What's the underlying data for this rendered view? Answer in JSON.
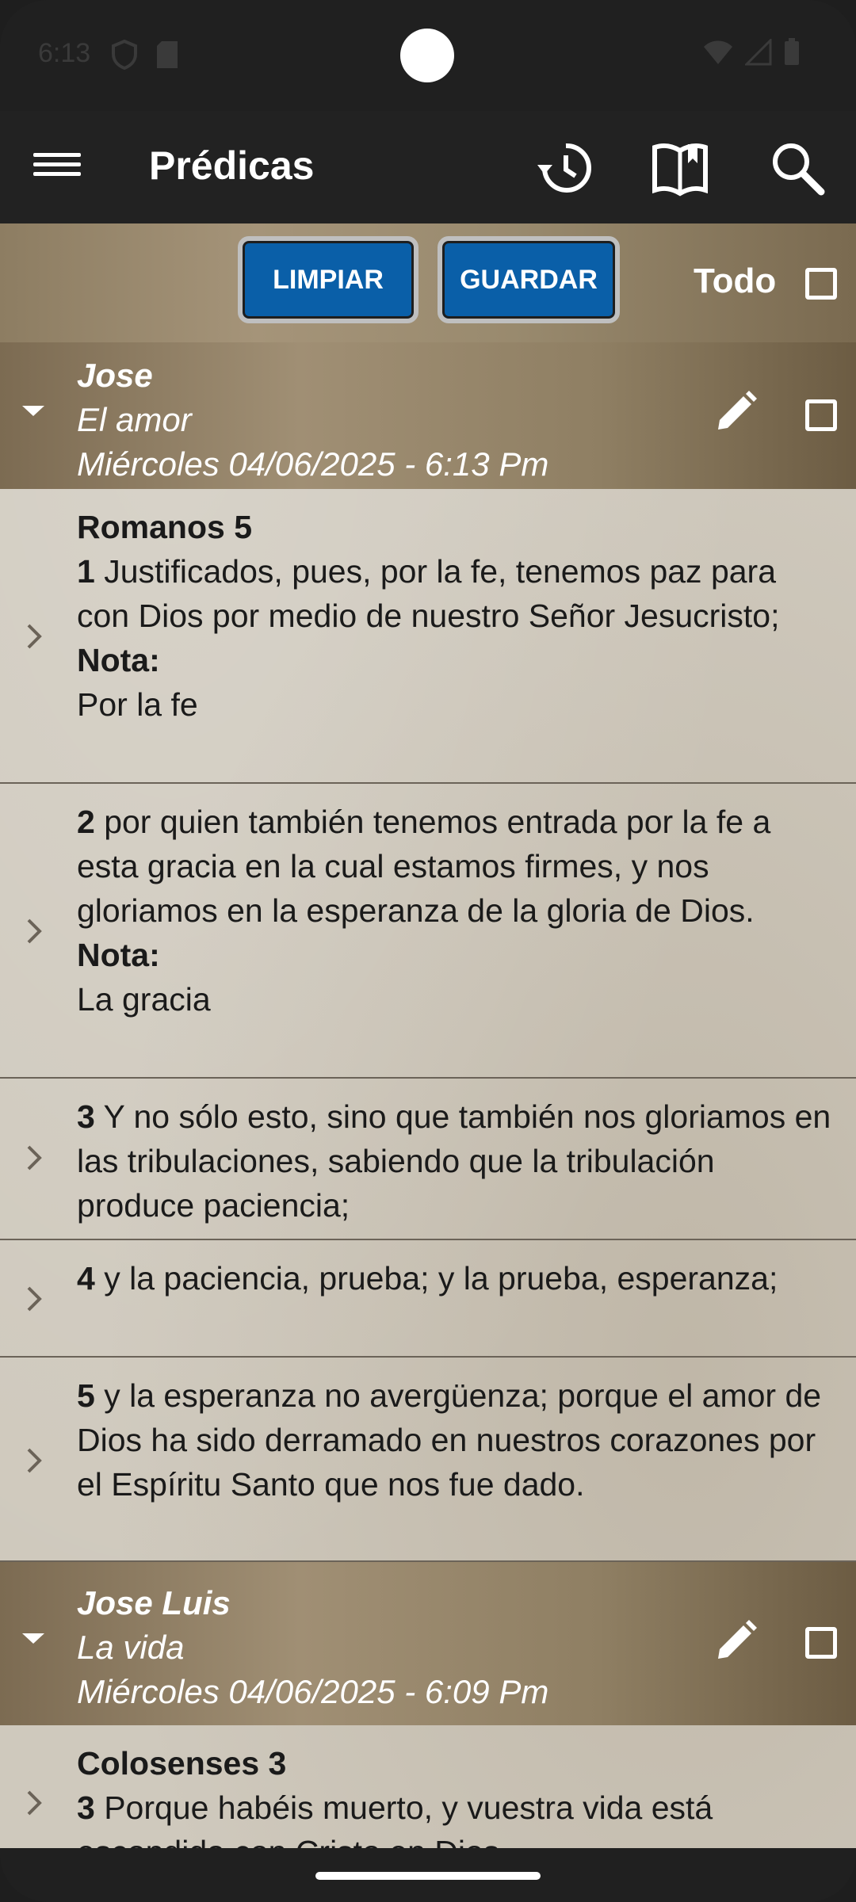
{
  "status_bar": {
    "time": "6:13"
  },
  "app_bar": {
    "title": "Prédicas",
    "icons": [
      "menu-icon",
      "history-icon",
      "book-icon",
      "search-icon"
    ]
  },
  "toolbar": {
    "clear_label": "LIMPIAR",
    "save_label": "GUARDAR",
    "all_label": "Todo"
  },
  "groups": [
    {
      "author": "Jose",
      "topic": "El amor",
      "date": "Miércoles 04/06/2025 - 6:13 Pm",
      "verses": [
        {
          "reference": "Romanos 5",
          "number": "1",
          "text": " Justificados, pues, por la fe, tenemos paz para con Dios por medio de nuestro Señor Jesucristo;",
          "note_label": "Nota:",
          "note": "Por la fe"
        },
        {
          "number": "2",
          "text": " por quien también tenemos entrada por la fe a esta gracia en la cual estamos firmes, y nos gloriamos en la esperanza de la gloria de Dios.",
          "note_label": "Nota:",
          "note": "La gracia"
        },
        {
          "number": "3",
          "text": " Y no sólo esto, sino que también nos gloriamos en las tribulaciones, sabiendo que la tribulación produce paciencia;"
        },
        {
          "number": "4",
          "text": " y la paciencia, prueba; y la prueba, esperanza;"
        },
        {
          "number": "5",
          "text": " y la esperanza no avergüenza; porque el amor de Dios ha sido derramado en nuestros corazones por el Espíritu Santo que nos fue dado."
        }
      ]
    },
    {
      "author": "Jose Luis",
      "topic": "La vida",
      "date": "Miércoles 04/06/2025 - 6:09 Pm",
      "verses": [
        {
          "reference": "Colosenses 3",
          "number": "3",
          "text": " Porque habéis muerto, y vuestra vida está escondida con Cristo en Dios."
        }
      ]
    }
  ]
}
